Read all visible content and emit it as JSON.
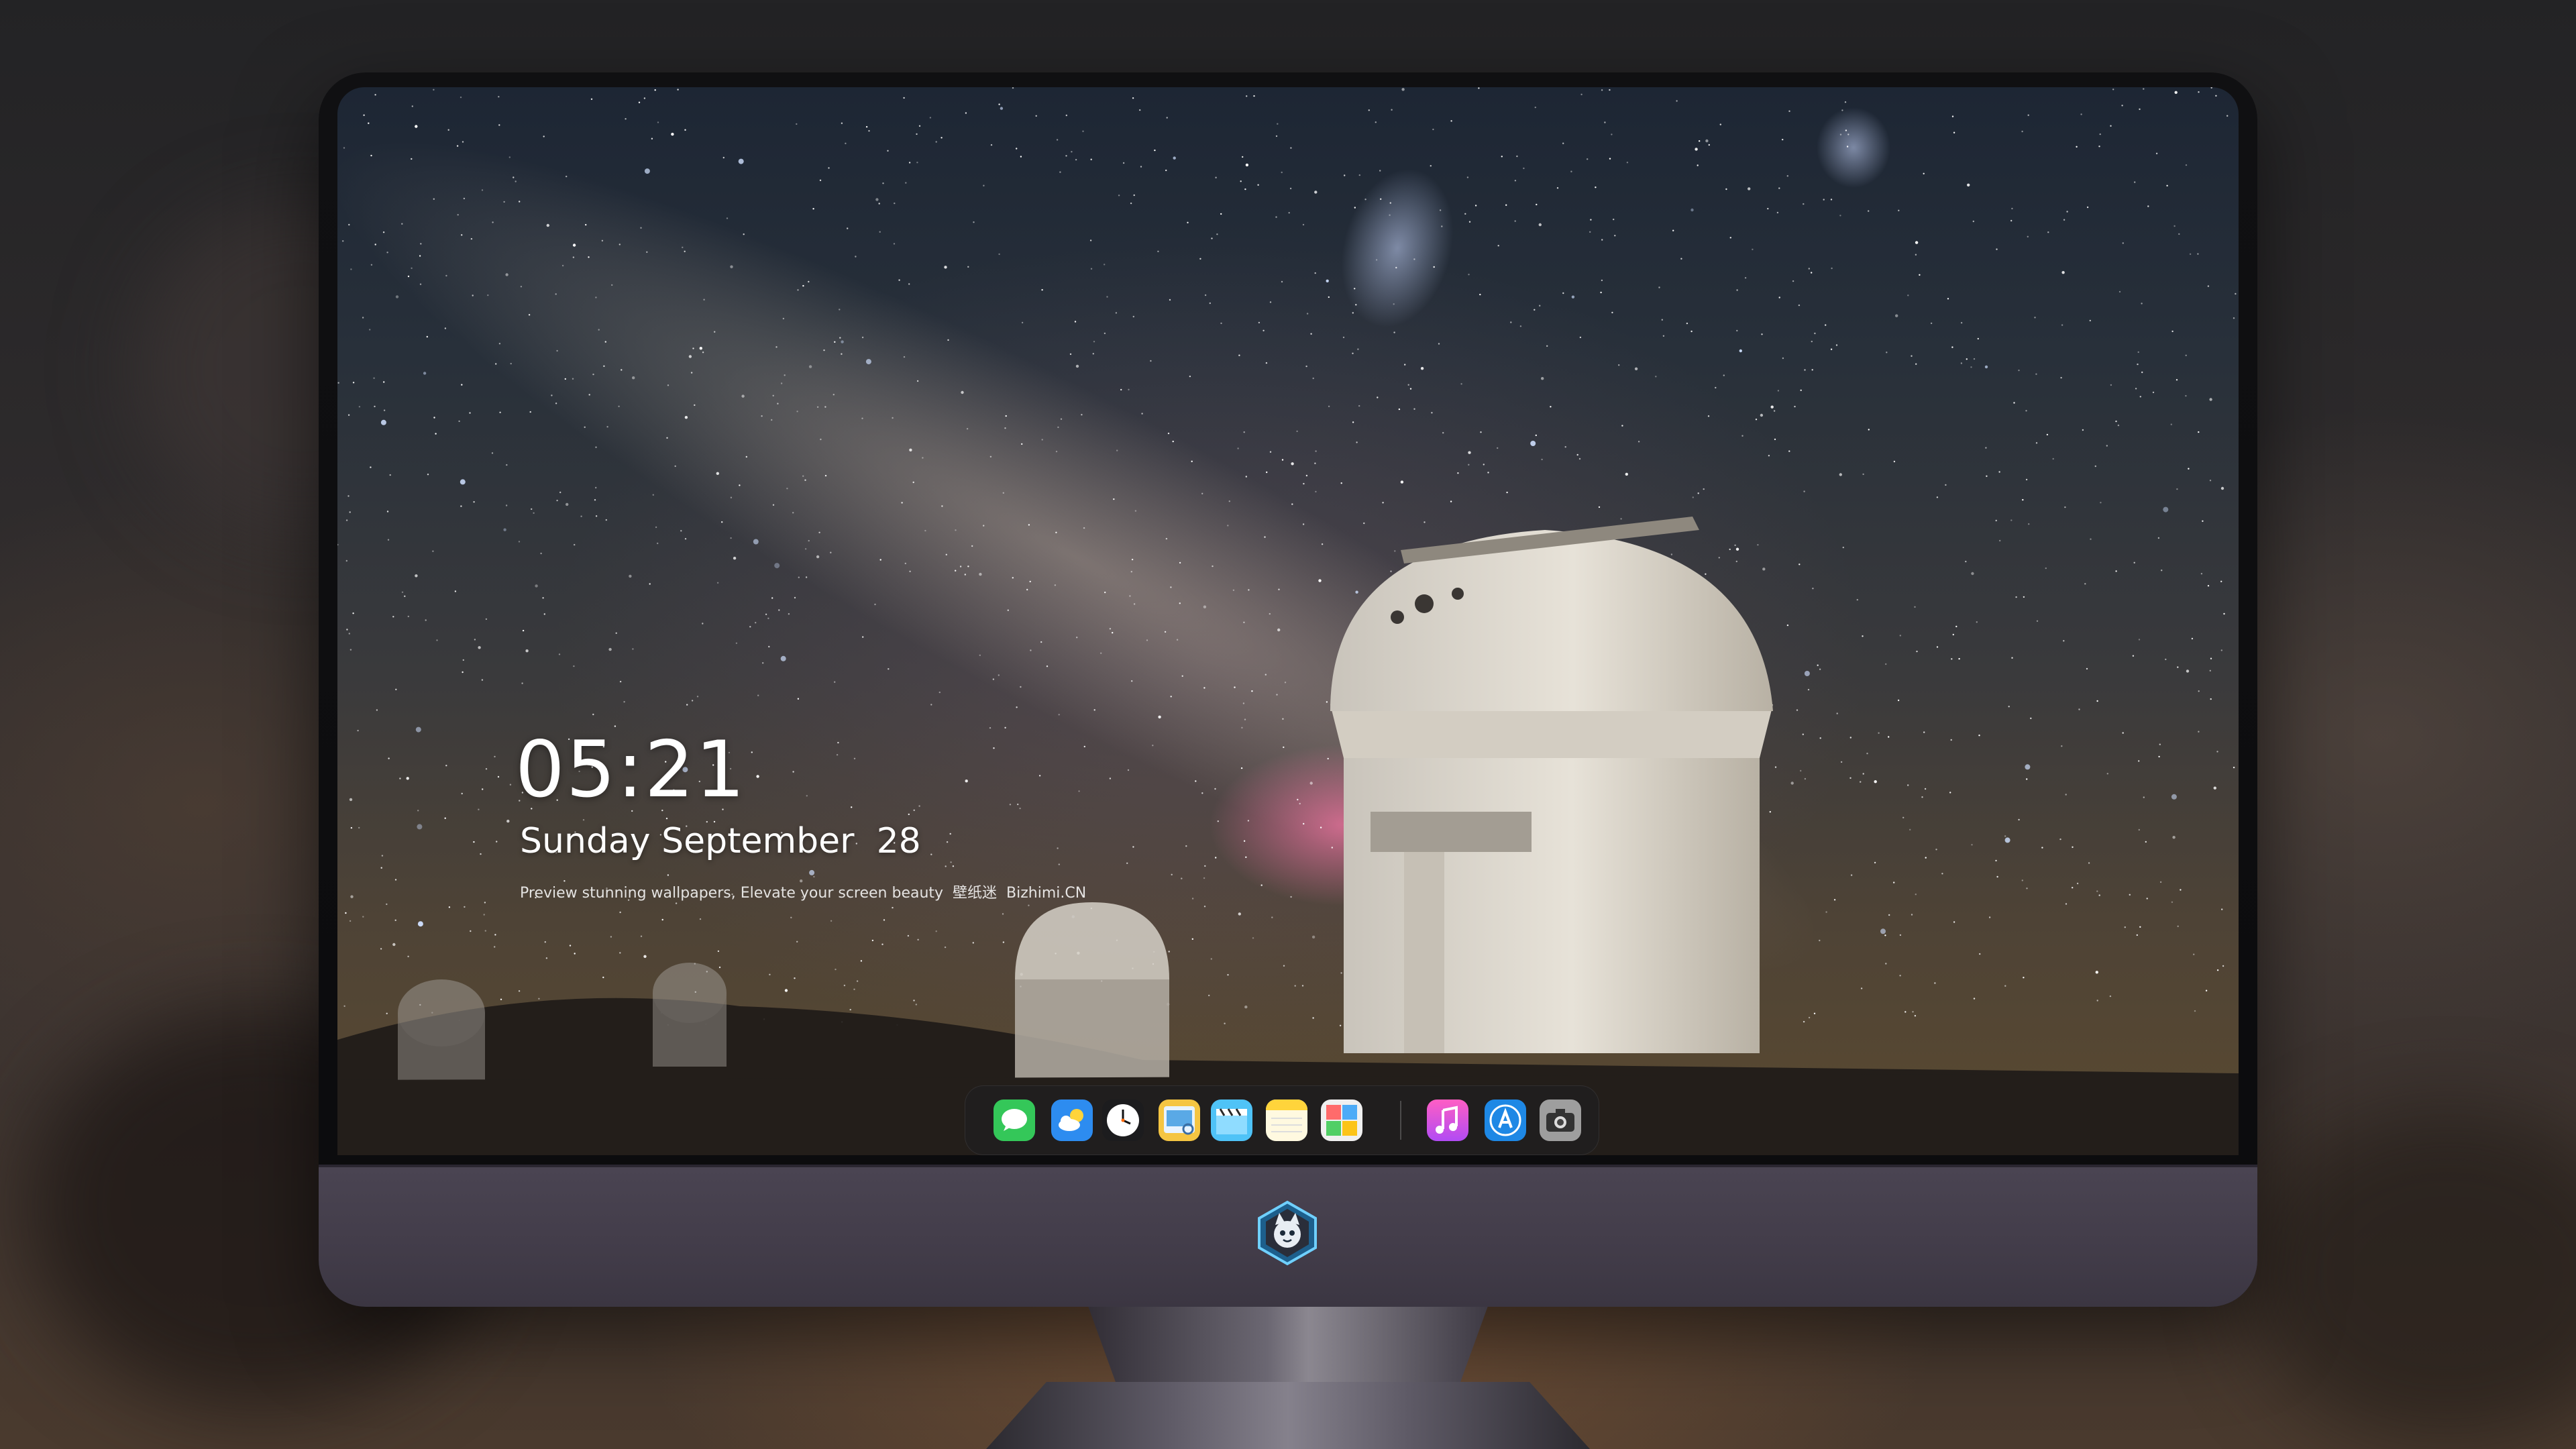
{
  "lockscreen": {
    "time": "05:21",
    "date": "Sunday September  28",
    "tagline": "Preview stunning wallpapers, Elevate your screen beauty  壁纸迷  Bizhimi.CN"
  },
  "dock": {
    "apps": [
      {
        "name": "messages",
        "icon": "messages-icon"
      },
      {
        "name": "weather",
        "icon": "weather-icon"
      },
      {
        "name": "clock",
        "icon": "clock-icon"
      },
      {
        "name": "preview",
        "icon": "preview-icon"
      },
      {
        "name": "clips",
        "icon": "clapperboard-icon"
      },
      {
        "name": "notes",
        "icon": "notes-icon"
      },
      {
        "name": "photo-booth",
        "icon": "photo-booth-icon"
      },
      {
        "name": "itunes",
        "icon": "music-note-icon"
      },
      {
        "name": "app-store",
        "icon": "app-store-icon"
      },
      {
        "name": "screenshot",
        "icon": "camera-icon"
      }
    ]
  },
  "monitor": {
    "logo": "mascot-logo"
  }
}
